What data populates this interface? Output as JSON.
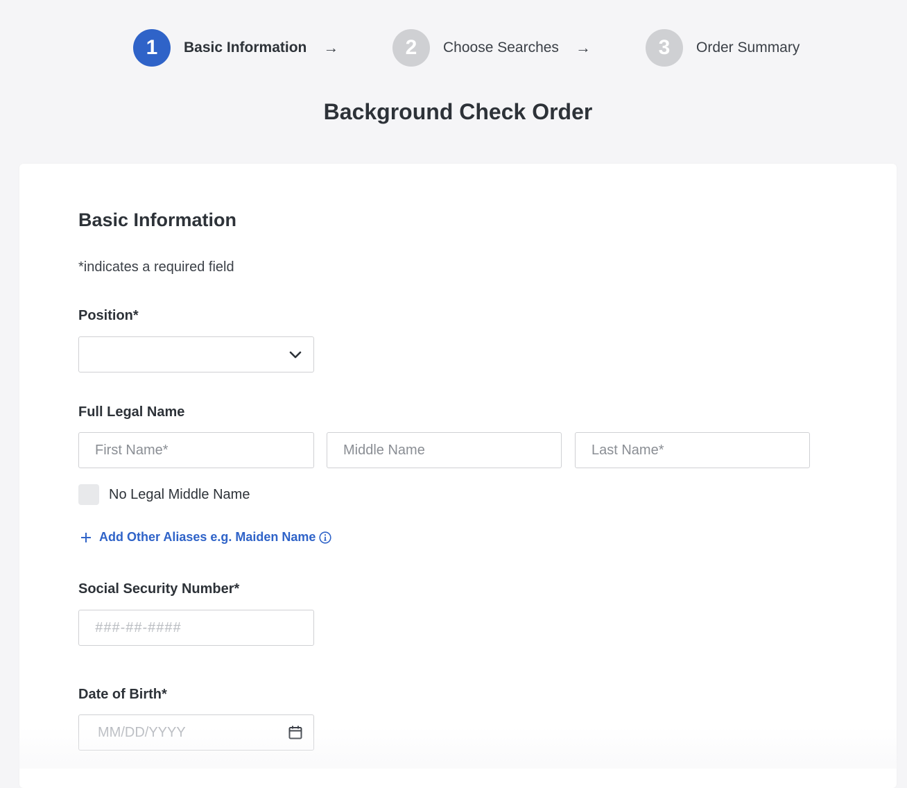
{
  "stepper": {
    "steps": [
      {
        "number": "1",
        "label": "Basic Information",
        "arrow": "→"
      },
      {
        "number": "2",
        "label": "Choose Searches",
        "arrow": "→"
      },
      {
        "number": "3",
        "label": "Order Summary"
      }
    ],
    "active_step": "1"
  },
  "page": {
    "title": "Background Check Order"
  },
  "form": {
    "section_title": "Basic Information",
    "required_note": "*indicates a required field",
    "position": {
      "label": "Position*",
      "value": ""
    },
    "full_legal_name": {
      "label": "Full Legal Name",
      "first_placeholder": "First Name*",
      "middle_placeholder": "Middle Name",
      "last_placeholder": "Last Name*"
    },
    "no_middle_name": {
      "label": "No Legal Middle Name",
      "checked": false
    },
    "add_aliases": {
      "label": "Add Other Aliases e.g. Maiden Name"
    },
    "ssn": {
      "label": "Social Security Number*",
      "placeholder": "###-##-####"
    },
    "dob": {
      "label": "Date of Birth*",
      "placeholder": "MM/DD/YYYY"
    }
  },
  "icons": {
    "dropdown": "chevron-down-icon",
    "calendar": "calendar-icon",
    "info": "info-icon",
    "add": "plus-icon"
  },
  "colors": {
    "accent": "#2f63c8",
    "inactive_step": "#cfd0d3",
    "background": "#f5f5f7",
    "text": "#2d3238"
  }
}
